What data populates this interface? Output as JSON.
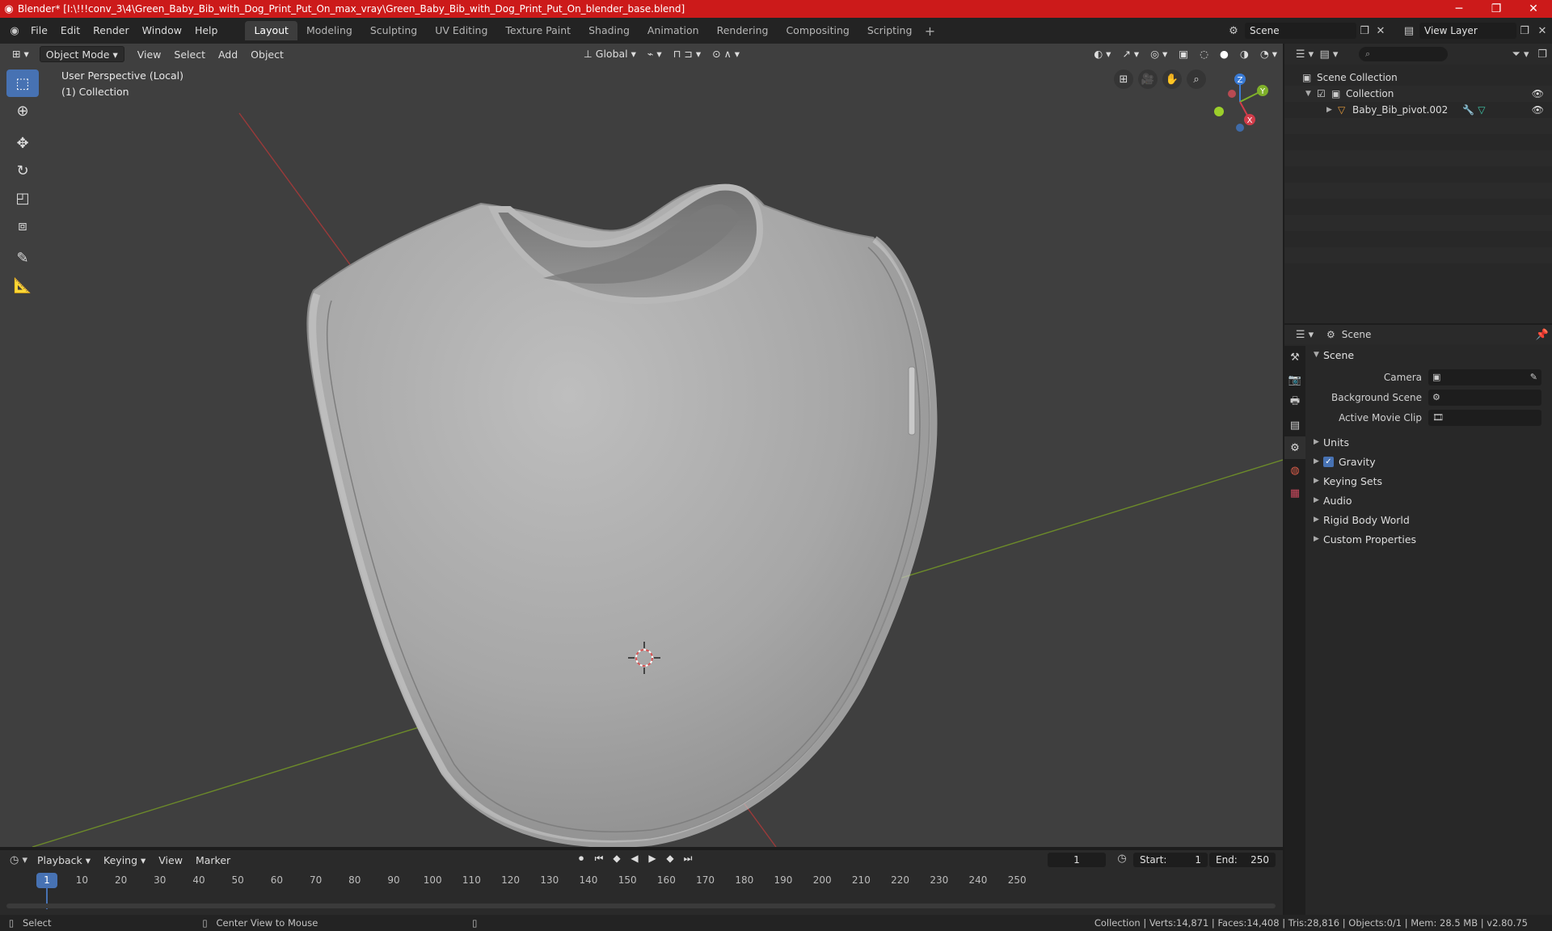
{
  "window": {
    "title": "Blender* [I:\\!!!conv_3\\4\\Green_Baby_Bib_with_Dog_Print_Put_On_max_vray\\Green_Baby_Bib_with_Dog_Print_Put_On_blender_base.blend]",
    "minimize": "─",
    "maximize": "❐",
    "close": "✕"
  },
  "menu": [
    "File",
    "Edit",
    "Render",
    "Window",
    "Help"
  ],
  "workspaces": [
    "Layout",
    "Modeling",
    "Sculpting",
    "UV Editing",
    "Texture Paint",
    "Shading",
    "Animation",
    "Rendering",
    "Compositing",
    "Scripting"
  ],
  "active_workspace": "Layout",
  "scene_field": "Scene",
  "view_layer_field": "View Layer",
  "viewport": {
    "mode": "Object Mode",
    "menus": [
      "View",
      "Select",
      "Add",
      "Object"
    ],
    "transform_orientation": "Global",
    "info_line1": "User Perspective (Local)",
    "info_line2": "(1) Collection"
  },
  "gizmo": {
    "x": "X",
    "y": "Y",
    "z": "Z"
  },
  "outliner": {
    "search_placeholder": "",
    "scene_collection": "Scene Collection",
    "collection": "Collection",
    "object": "Baby_Bib_pivot.002"
  },
  "properties": {
    "header": "Scene",
    "panel": "Scene",
    "camera_label": "Camera",
    "background_scene_label": "Background Scene",
    "active_movie_clip_label": "Active Movie Clip",
    "subpanels": [
      "Units",
      "Gravity",
      "Keying Sets",
      "Audio",
      "Rigid Body World",
      "Custom Properties"
    ]
  },
  "timeline": {
    "menus": [
      "Playback",
      "Keying",
      "View",
      "Marker"
    ],
    "current_frame": "1",
    "start_label": "Start:",
    "start_value": "1",
    "end_label": "End:",
    "end_value": "250",
    "ticks": [
      "10",
      "20",
      "30",
      "40",
      "50",
      "60",
      "70",
      "80",
      "90",
      "100",
      "110",
      "120",
      "130",
      "140",
      "150",
      "160",
      "170",
      "180",
      "190",
      "200",
      "210",
      "220",
      "230",
      "240",
      "250"
    ]
  },
  "statusbar": {
    "select": "Select",
    "center_view": "Center View to Mouse",
    "stats": "Collection | Verts:14,871 | Faces:14,408 | Tris:28,816 | Objects:0/1 | Mem: 28.5 MB | v2.80.75"
  }
}
